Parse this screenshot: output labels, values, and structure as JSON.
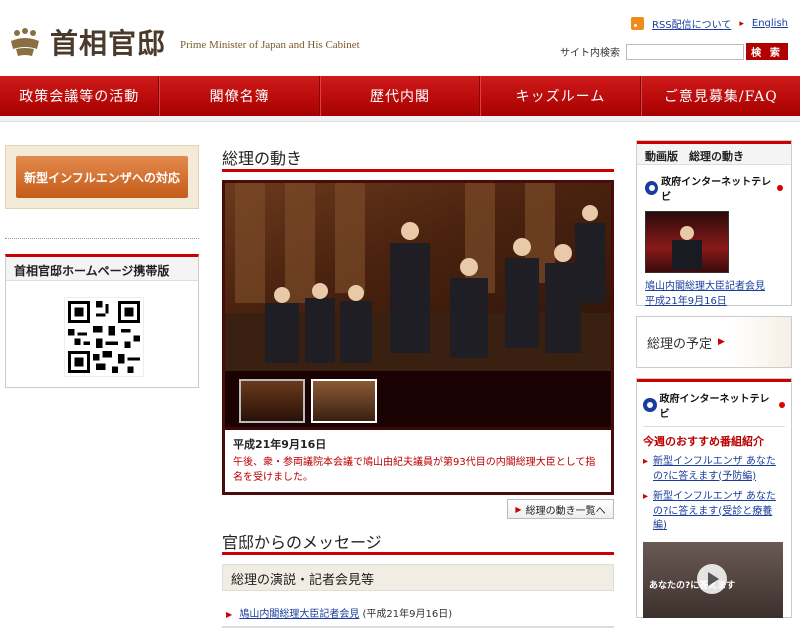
{
  "header": {
    "title_jp": "首相官邸",
    "title_en": "Prime Minister of Japan and His Cabinet",
    "rss_label": "RSS配信について",
    "english_label": "English",
    "search_label": "サイト内検索",
    "search_value": "",
    "search_button": "検 索"
  },
  "nav": {
    "items": [
      "政策会議等の活動",
      "閣僚名簿",
      "歴代内閣",
      "キッズルーム",
      "ご意見募集/FAQ"
    ]
  },
  "left": {
    "flu_button": "新型インフルエンザへの対応",
    "mobile_title": "首相官邸ホームページ携帯版"
  },
  "center": {
    "section1_title": "総理の動き",
    "caption_date": "平成21年9月16日",
    "caption_text": "午後、衆・参両議院本会議で鳩山由紀夫議員が第93代目の内閣総理大臣として指名を受けました。",
    "list_button": "総理の動き一覧へ",
    "section2_title": "官邸からのメッセージ",
    "subsection_title": "総理の演説・記者会見等",
    "news": {
      "link": "鳩山内閣総理大臣記者会見",
      "date": "(平成21年9月16日)"
    }
  },
  "right": {
    "video_title": "動画版　総理の動き",
    "tv_name": "政府インターネットテレビ",
    "video_link": "鳩山内閣総理大臣記者会見",
    "video_date": "平成21年9月16日",
    "schedule": "総理の予定",
    "tv_name2": "政府インターネットテレビ",
    "rec_title": "今週のおすすめ番組紹介",
    "rec_items": [
      "新型インフルエンザ あなたの?に答えます(予防編)",
      "新型インフルエンザ あなたの?に答えます(受診と療養編)"
    ],
    "promo_text": "あなたの?に答えます"
  },
  "colors": {
    "brand_red": "#c00000",
    "link_blue": "#1a3c9c",
    "flu_orange": "#d06a28"
  }
}
